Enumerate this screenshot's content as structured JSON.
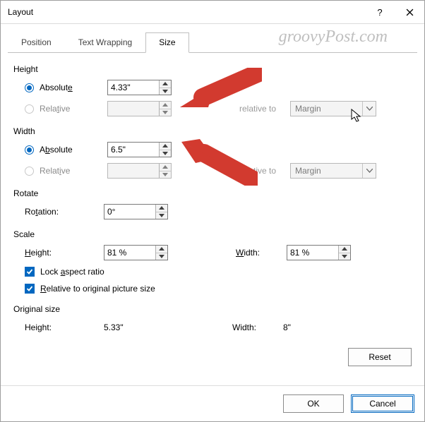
{
  "window": {
    "title": "Layout",
    "watermark": "groovyPost.com"
  },
  "tabs": {
    "position": "Position",
    "textwrap": "Text Wrapping",
    "size": "Size"
  },
  "height": {
    "section": "Height",
    "absolute_label": "Absolute",
    "absolute_value": "4.33\"",
    "relative_label": "Relative",
    "relative_value": "",
    "rel_to_label": "relative to",
    "rel_to_value": "Margin"
  },
  "width": {
    "section": "Width",
    "absolute_label": "Absolute",
    "absolute_value": "6.5\"",
    "relative_label": "Relative",
    "relative_value": "",
    "rel_to_label": "relative to",
    "rel_to_value": "Margin"
  },
  "rotate": {
    "section": "Rotate",
    "label": "Rotation:",
    "value": "0°"
  },
  "scale": {
    "section": "Scale",
    "h_label": "Height:",
    "h_value": "81 %",
    "w_label": "Width:",
    "w_value": "81 %",
    "lock_label": "Lock aspect ratio",
    "orig_label": "Relative to original picture size"
  },
  "original": {
    "section": "Original size",
    "h_label": "Height:",
    "h_value": "5.33\"",
    "w_label": "Width:",
    "w_value": "8\""
  },
  "buttons": {
    "reset": "Reset",
    "ok": "OK",
    "cancel": "Cancel"
  }
}
